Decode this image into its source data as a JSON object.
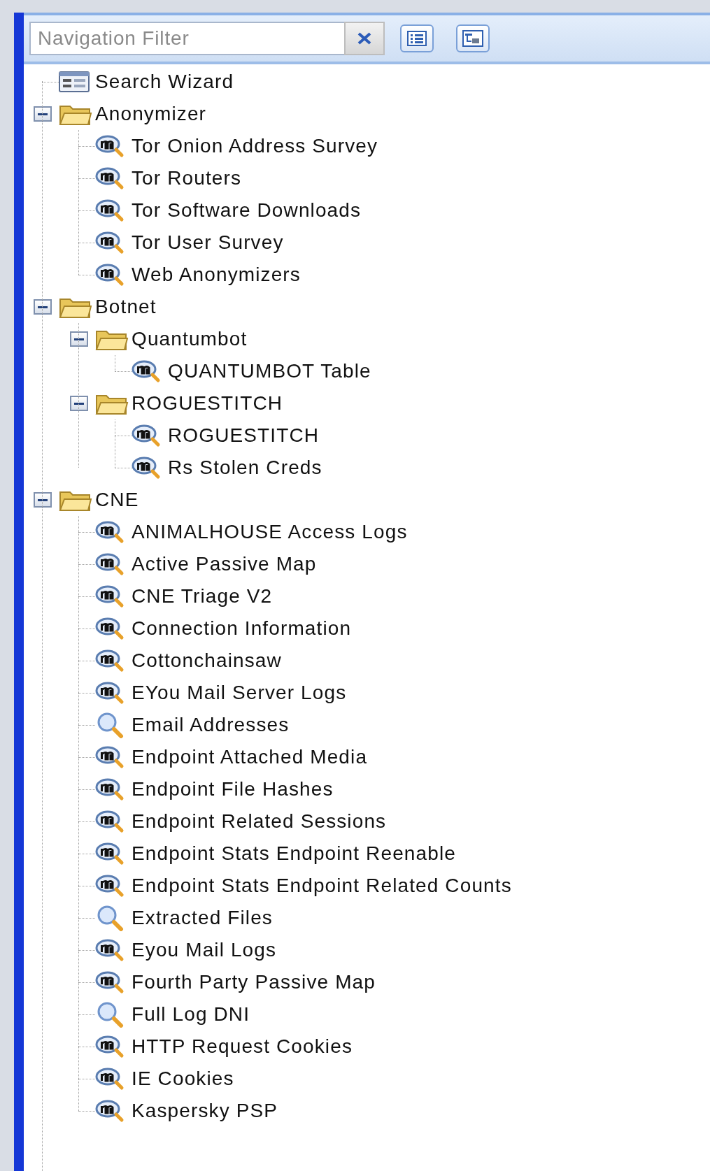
{
  "filter": {
    "placeholder": "Navigation Filter"
  },
  "tree": [
    {
      "label": "Search Wizard",
      "kind": "wizard"
    },
    {
      "label": "Anonymizer",
      "kind": "folder",
      "expanded": true,
      "children": [
        {
          "label": "Tor Onion Address Survey",
          "kind": "table"
        },
        {
          "label": "Tor Routers",
          "kind": "table"
        },
        {
          "label": "Tor Software Downloads",
          "kind": "table"
        },
        {
          "label": "Tor User Survey",
          "kind": "table"
        },
        {
          "label": "Web Anonymizers",
          "kind": "table"
        }
      ]
    },
    {
      "label": "Botnet",
      "kind": "folder",
      "expanded": true,
      "children": [
        {
          "label": "Quantumbot",
          "kind": "folder",
          "expanded": true,
          "children": [
            {
              "label": "QUANTUMBOT Table",
              "kind": "table"
            }
          ]
        },
        {
          "label": "ROGUESTITCH",
          "kind": "folder",
          "expanded": true,
          "children": [
            {
              "label": "ROGUESTITCH",
              "kind": "table"
            },
            {
              "label": "Rs Stolen Creds",
              "kind": "table"
            }
          ]
        }
      ]
    },
    {
      "label": "CNE",
      "kind": "folder",
      "expanded": true,
      "children": [
        {
          "label": "ANIMALHOUSE Access Logs",
          "kind": "table"
        },
        {
          "label": "Active Passive Map",
          "kind": "table"
        },
        {
          "label": "CNE Triage V2",
          "kind": "table"
        },
        {
          "label": "Connection Information",
          "kind": "table"
        },
        {
          "label": "Cottonchainsaw",
          "kind": "table"
        },
        {
          "label": "EYou Mail Server Logs",
          "kind": "table"
        },
        {
          "label": "Email Addresses",
          "kind": "search"
        },
        {
          "label": "Endpoint Attached Media",
          "kind": "table"
        },
        {
          "label": "Endpoint File Hashes",
          "kind": "table"
        },
        {
          "label": "Endpoint Related Sessions",
          "kind": "table"
        },
        {
          "label": "Endpoint Stats Endpoint Reenable",
          "kind": "table"
        },
        {
          "label": "Endpoint Stats Endpoint Related Counts",
          "kind": "table"
        },
        {
          "label": "Extracted Files",
          "kind": "search"
        },
        {
          "label": "Eyou Mail Logs",
          "kind": "table"
        },
        {
          "label": "Fourth Party Passive Map",
          "kind": "table"
        },
        {
          "label": "Full Log DNI",
          "kind": "search"
        },
        {
          "label": "HTTP Request Cookies",
          "kind": "table"
        },
        {
          "label": "IE Cookies",
          "kind": "table"
        },
        {
          "label": "Kaspersky PSP",
          "kind": "table"
        }
      ]
    }
  ]
}
